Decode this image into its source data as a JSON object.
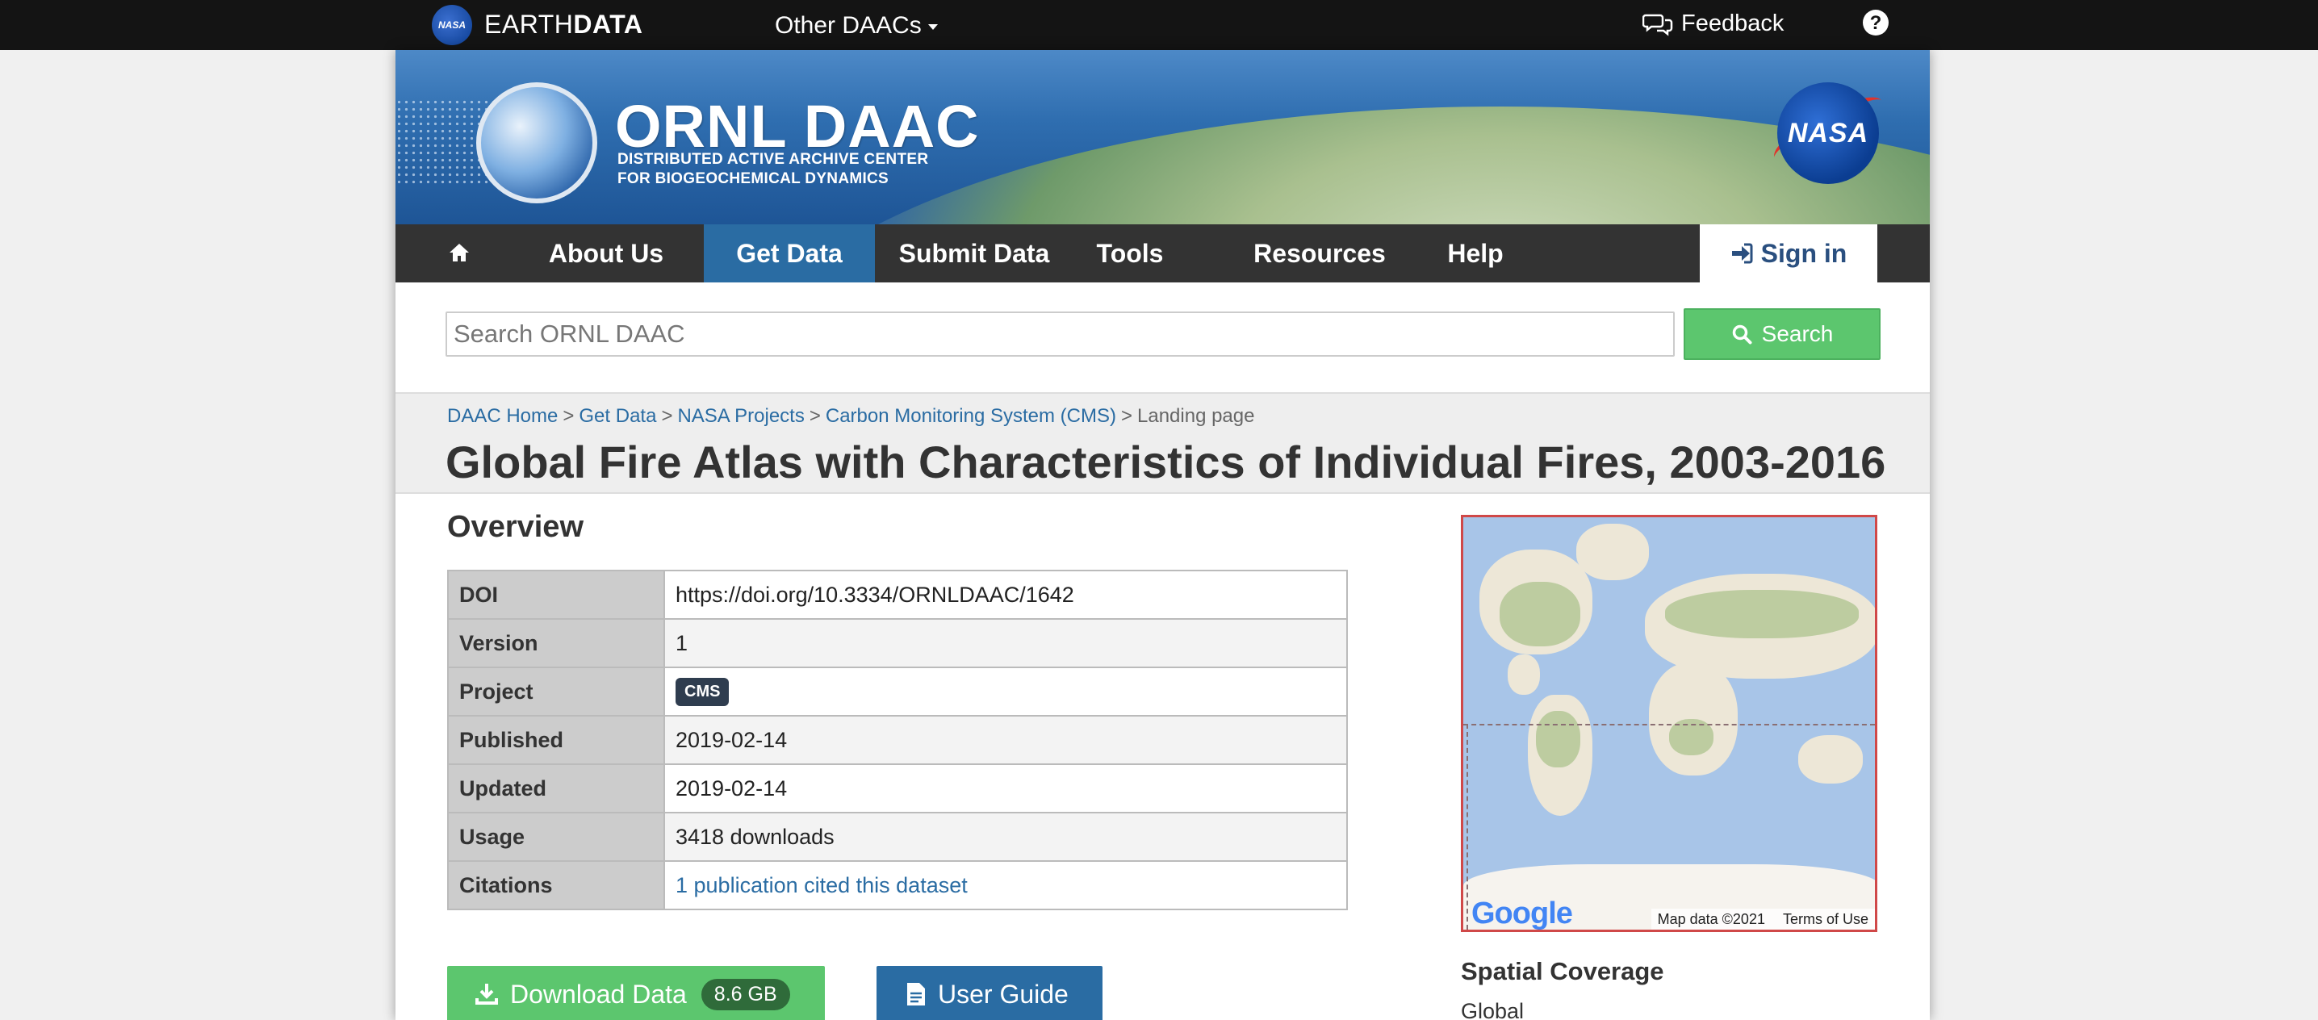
{
  "earthdata": {
    "logo_text": "NASA",
    "brand_light": "EARTH",
    "brand_bold": "DATA",
    "other_daacs": "Other DAACs",
    "feedback": "Feedback",
    "help": "?"
  },
  "banner": {
    "title": "ORNL DAAC",
    "subtitle_line1": "DISTRIBUTED ACTIVE ARCHIVE CENTER",
    "subtitle_line2": "FOR BIOGEOCHEMICAL DYNAMICS",
    "nasa_logo": "NASA"
  },
  "nav": {
    "items": [
      "About Us",
      "Get Data",
      "Submit Data",
      "Tools",
      "Resources",
      "Help"
    ],
    "active": "Get Data",
    "signin": "Sign in"
  },
  "search": {
    "placeholder": "Search ORNL DAAC",
    "button": "Search"
  },
  "breadcrumb": {
    "items": [
      "DAAC Home",
      "Get Data",
      "NASA Projects",
      "Carbon Monitoring System (CMS)"
    ],
    "current": "Landing page"
  },
  "title": "Global Fire Atlas with Characteristics of Individual Fires, 2003-2016",
  "overview": {
    "heading": "Overview",
    "rows": [
      {
        "label": "DOI",
        "value": "https://doi.org/10.3334/ORNLDAAC/1642"
      },
      {
        "label": "Version",
        "value": "1"
      },
      {
        "label": "Project",
        "value": "CMS"
      },
      {
        "label": "Published",
        "value": "2019-02-14"
      },
      {
        "label": "Updated",
        "value": "2019-02-14"
      },
      {
        "label": "Usage",
        "value": "3418 downloads"
      },
      {
        "label": "Citations",
        "value": "1 publication cited this dataset"
      }
    ]
  },
  "actions": {
    "download": "Download Data",
    "download_size": "8.6 GB",
    "user_guide": "User Guide"
  },
  "map": {
    "google": "Google",
    "map_data": "Map data ©2021",
    "terms": "Terms of Use"
  },
  "spatial": {
    "heading": "Spatial Coverage",
    "value": "Global"
  },
  "colors": {
    "accent_blue": "#2a6ca3",
    "green": "#5cc66e",
    "nav_bg": "#333333"
  }
}
